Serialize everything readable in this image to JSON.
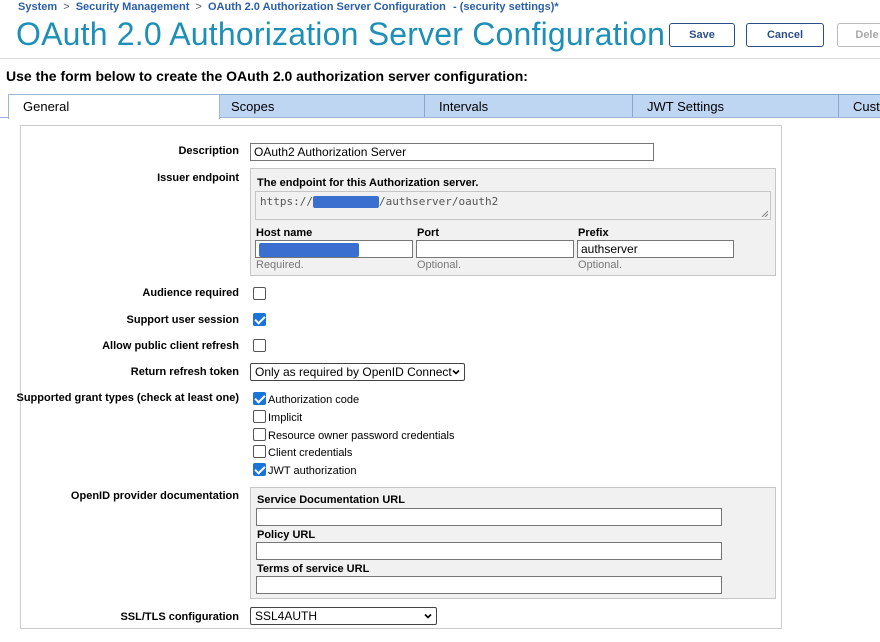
{
  "breadcrumb": {
    "items": [
      "System",
      "Security Management",
      "OAuth 2.0 Authorization Server Configuration"
    ],
    "separator": ">",
    "suffix": "- (security settings)*"
  },
  "page_title": "OAuth 2.0 Authorization Server Configuration",
  "buttons": {
    "save": "Save",
    "cancel": "Cancel",
    "delete": "Dele"
  },
  "instruction": "Use the form below to create the OAuth 2.0 authorization server configuration:",
  "tabs": [
    {
      "label": "General",
      "active": true
    },
    {
      "label": "Scopes",
      "active": false
    },
    {
      "label": "Intervals",
      "active": false
    },
    {
      "label": "JWT Settings",
      "active": false
    },
    {
      "label": "Custo",
      "active": false
    }
  ],
  "form": {
    "description": {
      "label": "Description",
      "value": "OAuth2 Authorization Server"
    },
    "issuer": {
      "label": "Issuer endpoint",
      "heading": "The endpoint for this Authorization server.",
      "url_prefix": "https://",
      "url_suffix": "/authserver/oauth2",
      "host": {
        "label": "Host name",
        "value": "",
        "hint": "Required."
      },
      "port": {
        "label": "Port",
        "value": "",
        "hint": "Optional."
      },
      "prefix": {
        "label": "Prefix",
        "value": "authserver",
        "hint": "Optional."
      }
    },
    "audience_required": {
      "label": "Audience required",
      "checked": false
    },
    "support_user_session": {
      "label": "Support user session",
      "checked": true
    },
    "allow_public_client_refresh": {
      "label": "Allow public client refresh",
      "checked": false
    },
    "return_refresh_token": {
      "label": "Return refresh token",
      "value": "Only as required by OpenID Connect"
    },
    "grant_types": {
      "label": "Supported grant types (check at least one)",
      "options": [
        {
          "label": "Authorization code",
          "checked": true
        },
        {
          "label": "Implicit",
          "checked": false
        },
        {
          "label": "Resource owner password credentials",
          "checked": false
        },
        {
          "label": "Client credentials",
          "checked": false
        },
        {
          "label": "JWT authorization",
          "checked": true
        }
      ]
    },
    "openid_docs": {
      "label": "OpenID provider documentation",
      "service_doc": {
        "label": "Service Documentation URL",
        "value": ""
      },
      "policy": {
        "label": "Policy URL",
        "value": ""
      },
      "tos": {
        "label": "Terms of service URL",
        "value": ""
      }
    },
    "ssl_tls": {
      "label": "SSL/TLS configuration",
      "value": "SSL4AUTH"
    }
  },
  "colors": {
    "title": "#1e90b8",
    "link": "#2b5fa8",
    "tab_inactive": "#bfd6f2",
    "redaction": "#3a6fd0",
    "checkbox": "#1a73d6"
  }
}
